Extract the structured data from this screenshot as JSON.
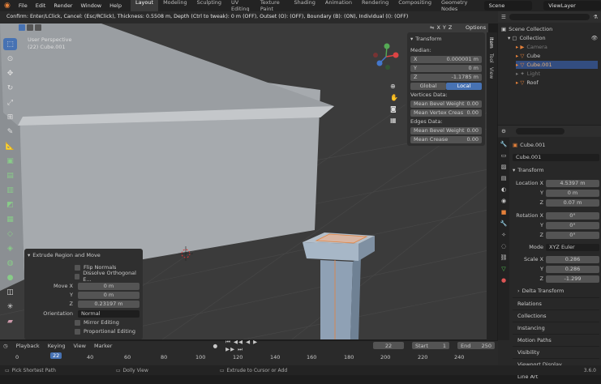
{
  "menu": {
    "items": [
      "File",
      "Edit",
      "Render",
      "Window",
      "Help"
    ]
  },
  "workspaces": {
    "tabs": [
      "Layout",
      "Modeling",
      "Sculpting",
      "UV Editing",
      "Texture Paint",
      "Shading",
      "Animation",
      "Rendering",
      "Compositing",
      "Geometry Nodes"
    ],
    "active": "Layout"
  },
  "scene": {
    "label": "Scene"
  },
  "viewlayer": {
    "label": "ViewLayer"
  },
  "status_line": "Confirm: Enter/LClick, Cancel: (Esc/RClick), Thickness: 0.5508 m, Depth (Ctrl to tweak): 0 m (OFF), Outset (O): (OFF), Boundary (B): (ON), Individual (I): (OFF)",
  "viewport": {
    "perspective": "User Perspective",
    "object": "(22) Cube.001",
    "axis": [
      "X",
      "Y",
      "Z"
    ],
    "options": "Options"
  },
  "npanel": {
    "title": "Transform",
    "median": "Median:",
    "x_label": "X",
    "x_val": "0.000001 m",
    "y_label": "Y",
    "y_val": "0 m",
    "z_label": "Z",
    "z_val": "-1.1785 m",
    "global": "Global",
    "local": "Local",
    "vertices_data": "Vertices Data:",
    "mean_bevel_weight_v": "Mean Bevel Weight",
    "mbw_v_val": "0.00",
    "mean_vertex_crease": "Mean Vertex Creas",
    "mvc_val": "0.00",
    "edges_data": "Edges Data:",
    "mean_bevel_weight_e": "Mean Bevel Weight",
    "mbw_e_val": "0.00",
    "mean_crease": "Mean Crease",
    "mc_val": "0.00"
  },
  "side_tabs": [
    "Item",
    "Tool",
    "View"
  ],
  "outliner": {
    "scene_collection": "Scene Collection",
    "items": [
      {
        "name": "Collection",
        "indent": 1,
        "dim": false
      },
      {
        "name": "Camera",
        "indent": 2,
        "dim": true
      },
      {
        "name": "Cube",
        "indent": 2,
        "dim": false
      },
      {
        "name": "Cube.001",
        "indent": 2,
        "dim": false,
        "selected": true
      },
      {
        "name": "Light",
        "indent": 2,
        "dim": true
      },
      {
        "name": "Roof",
        "indent": 2,
        "dim": false
      }
    ]
  },
  "properties": {
    "object_name": "Cube.001",
    "object_field": "Cube.001",
    "transform": "Transform",
    "location_x": "Location X",
    "loc_x": "4.5397 m",
    "loc_y_label": "Y",
    "loc_y": "0 m",
    "loc_z_label": "Z",
    "loc_z": "0.07 m",
    "rotation_x": "Rotation X",
    "rot_x": "0°",
    "rot_y_label": "Y",
    "rot_y": "0°",
    "rot_z_label": "Z",
    "rot_z": "0°",
    "mode_label": "Mode",
    "mode": "XYZ Euler",
    "scale_x": "Scale X",
    "sc_x": "0.286",
    "sc_y_label": "Y",
    "sc_y": "0.286",
    "sc_z_label": "Z",
    "sc_z": "-1.299",
    "delta": "Delta Transform",
    "sections": [
      "Relations",
      "Collections",
      "Instancing",
      "Motion Paths",
      "Visibility",
      "Viewport Display",
      "Line Art"
    ]
  },
  "redo_panel": {
    "title": "Extrude Region and Move",
    "flip_normals": "Flip Normals",
    "dissolve": "Dissolve Orthogonal E...",
    "move_x_label": "Move X",
    "move_x": "0 m",
    "move_y_label": "Y",
    "move_y": "0 m",
    "move_z_label": "Z",
    "move_z": "0.23197 m",
    "orientation_label": "Orientation",
    "orientation": "Normal",
    "mirror": "Mirror Editing",
    "proportional": "Proportional Editing"
  },
  "timeline": {
    "menus": [
      "Playback",
      "Keying",
      "View",
      "Marker"
    ],
    "current": "22",
    "start_label": "Start",
    "start": "1",
    "end_label": "End",
    "end": "250",
    "ticks": [
      "0",
      "20",
      "40",
      "60",
      "80",
      "100",
      "120",
      "140",
      "160",
      "180",
      "200",
      "220",
      "240"
    ],
    "frame_marker": "22"
  },
  "statusbar": {
    "left": "Pick Shortest Path",
    "mid": "Dolly View",
    "right": "Extrude to Cursor or Add",
    "version": "3.6.0"
  },
  "colors": {
    "accent": "#4772b3",
    "orange": "#e5813a",
    "viewport": "#3a3a3a"
  }
}
